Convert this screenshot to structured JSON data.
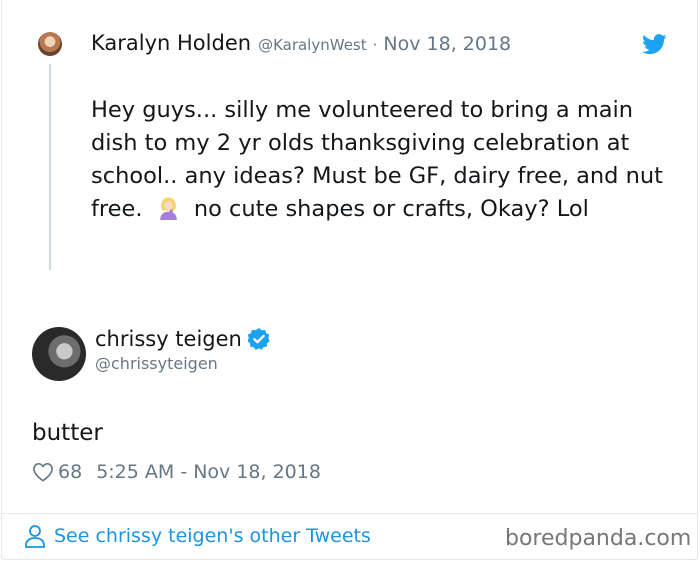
{
  "parent_tweet": {
    "name": "Karalyn Holden",
    "handle": "@KaralynWest",
    "separator": "·",
    "date": "Nov 18, 2018",
    "text_before_emoji": "Hey guys... silly me volunteered to bring a main dish to my 2 yr olds thanksgiving celebration at school.. any ideas? Must be GF, dairy free, and nut free.",
    "emoji": "woman-facepalming-emoji",
    "text_after_emoji": "no cute shapes or crafts, Okay? Lol"
  },
  "reply_tweet": {
    "name": "chrissy teigen",
    "handle": "@chrissyteigen",
    "verified": true,
    "text": "butter",
    "likes": "68",
    "timestamp": "5:25 AM - Nov 18, 2018"
  },
  "footer": {
    "link_label": "See chrissy teigen's other Tweets"
  },
  "watermark": "boredpanda.com",
  "colors": {
    "twitter_blue": "#1da1f2",
    "link_blue": "#1b95e0",
    "secondary_text": "#657786",
    "primary_text": "#14171a"
  },
  "icons": [
    "twitter-bird-icon",
    "verified-badge-icon",
    "heart-icon",
    "person-icon"
  ]
}
